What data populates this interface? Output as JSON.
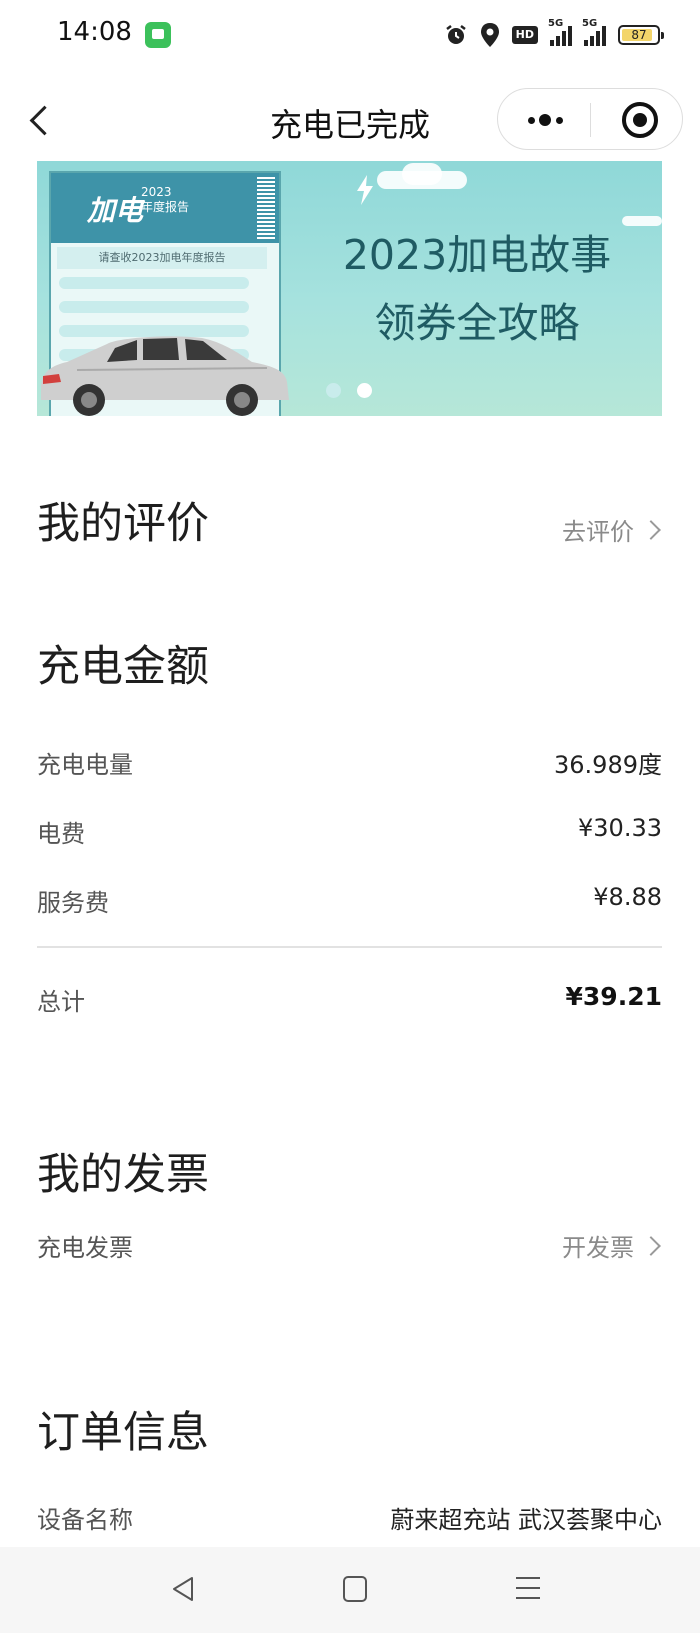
{
  "status_bar": {
    "time": "14:08",
    "hd_label": "HD",
    "signal1_label": "5G",
    "signal2_label": "5G",
    "battery_level": "87",
    "battery_fill": 0.87,
    "battery_color": "#f3d56a"
  },
  "nav": {
    "title": "充电已完成",
    "back_icon": "chevron-left-icon",
    "more_icon": "more-dots-icon",
    "close_icon": "target-close-icon"
  },
  "banner": {
    "title_line1": "2023加电故事",
    "title_line2": "领券全攻略",
    "card_logo": "加电",
    "card_year": "2023",
    "card_subtitle": "年度报告",
    "card_prompt": "请查收2023加电年度报告",
    "dots_total": 2,
    "active_dot": 2,
    "text_color": "#1f5b63"
  },
  "review": {
    "title": "我的评价",
    "link_label": "去评价"
  },
  "charge_amount": {
    "title": "充电金额",
    "rows": [
      {
        "label": "充电电量",
        "value": "36.989度"
      },
      {
        "label": "电费",
        "value": "¥30.33"
      },
      {
        "label": "服务费",
        "value": "¥8.88"
      }
    ],
    "total_label": "总计",
    "total_value": "¥39.21"
  },
  "invoice": {
    "title": "我的发票",
    "row_label": "充电发票",
    "link_label": "开发票"
  },
  "order": {
    "title": "订单信息",
    "device_label": "设备名称",
    "device_value": "蔚来超充站 武汉荟聚中心"
  },
  "system_nav": {
    "back_icon": "triangle-back-icon",
    "home_icon": "square-home-icon",
    "menu_icon": "hamburger-menu-icon"
  }
}
